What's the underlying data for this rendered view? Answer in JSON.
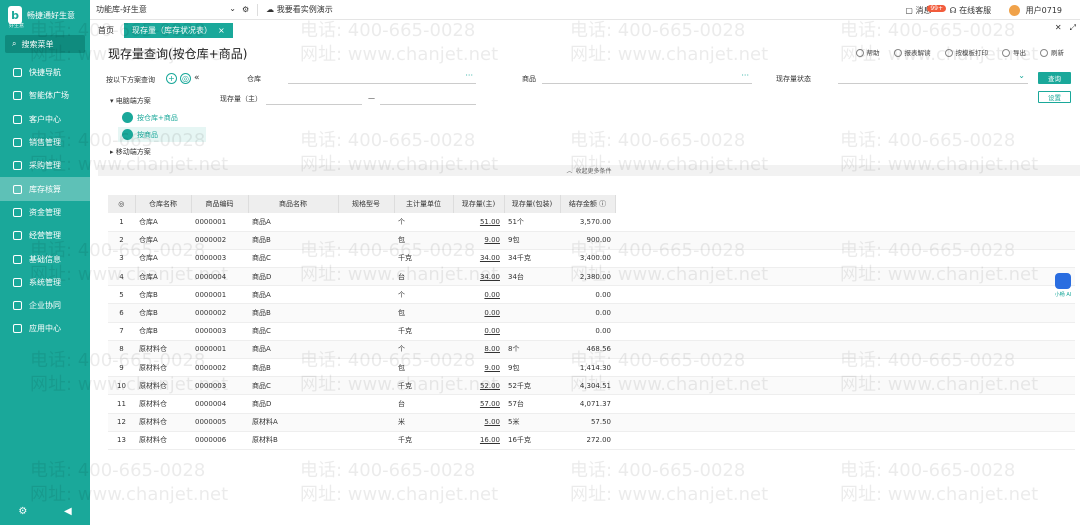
{
  "sidebar": {
    "brand": "畅捷通好生意",
    "brand_sub": "好生意",
    "search_label": "搜索菜单",
    "items": [
      {
        "label": "快捷导航",
        "icon": "home-icon"
      },
      {
        "label": "智能体广场",
        "icon": "robot-icon"
      },
      {
        "label": "客户中心",
        "icon": "customer-icon"
      },
      {
        "label": "销售管理",
        "icon": "sales-icon"
      },
      {
        "label": "采购管理",
        "icon": "purchase-icon"
      },
      {
        "label": "库存核算",
        "icon": "inventory-icon",
        "active": true
      },
      {
        "label": "资金管理",
        "icon": "fund-icon"
      },
      {
        "label": "经营管理",
        "icon": "business-icon"
      },
      {
        "label": "基础信息",
        "icon": "info-icon"
      },
      {
        "label": "系统管理",
        "icon": "system-icon"
      },
      {
        "label": "企业协同",
        "icon": "collab-icon"
      },
      {
        "label": "应用中心",
        "icon": "apps-icon"
      }
    ]
  },
  "topbar": {
    "func_library": "功能库-好生意",
    "demo_label": "我要看实例演示",
    "messages_label": "消息",
    "messages_badge": "99+",
    "service_label": "在线客服",
    "user_label": "用户0719"
  },
  "tabs": {
    "home": "首页",
    "active": "现存量（库存状况表）"
  },
  "header": {
    "title": "现存量查询(按仓库+商品)",
    "actions": [
      "帮助",
      "报表解读",
      "按模板打印",
      "导出",
      "刷新"
    ]
  },
  "scheme": {
    "title": "按以下方案查询",
    "group_pc": "电脑端方案",
    "item1": "按仓库+商品",
    "item2": "按商品",
    "group_mobile": "移动端方案"
  },
  "filters": {
    "warehouse_label": "仓库",
    "product_label": "商品",
    "status_label": "现存量状态",
    "qty_label": "现存量（主）",
    "range_sep": "—",
    "query_btn": "查询",
    "setting_btn": "设置",
    "collapse_label": "收起更多条件"
  },
  "table": {
    "columns": [
      "",
      "仓库名称",
      "商品编码",
      "商品名称",
      "规格型号",
      "主计量单位",
      "现存量(主)",
      "现存量(包装)",
      "结存金额 ⓘ"
    ],
    "rows": [
      [
        "1",
        "仓库A",
        "0000001",
        "商品A",
        "",
        "个",
        "51.00",
        "51个",
        "3,570.00"
      ],
      [
        "2",
        "仓库A",
        "0000002",
        "商品B",
        "",
        "包",
        "9.00",
        "9包",
        "900.00"
      ],
      [
        "3",
        "仓库A",
        "0000003",
        "商品C",
        "",
        "千克",
        "34.00",
        "34千克",
        "3,400.00"
      ],
      [
        "4",
        "仓库A",
        "0000004",
        "商品D",
        "",
        "台",
        "34.00",
        "34台",
        "2,380.00"
      ],
      [
        "5",
        "仓库B",
        "0000001",
        "商品A",
        "",
        "个",
        "0.00",
        "",
        "0.00"
      ],
      [
        "6",
        "仓库B",
        "0000002",
        "商品B",
        "",
        "包",
        "0.00",
        "",
        "0.00"
      ],
      [
        "7",
        "仓库B",
        "0000003",
        "商品C",
        "",
        "千克",
        "0.00",
        "",
        "0.00"
      ],
      [
        "8",
        "原材料仓",
        "0000001",
        "商品A",
        "",
        "个",
        "8.00",
        "8个",
        "468.56"
      ],
      [
        "9",
        "原材料仓",
        "0000002",
        "商品B",
        "",
        "包",
        "9.00",
        "9包",
        "1,414.30"
      ],
      [
        "10",
        "原材料仓",
        "0000003",
        "商品C",
        "",
        "千克",
        "52.00",
        "52千克",
        "4,304.51"
      ],
      [
        "11",
        "原材料仓",
        "0000004",
        "商品D",
        "",
        "台",
        "57.00",
        "57台",
        "4,071.37"
      ],
      [
        "12",
        "原材料仓",
        "0000005",
        "原材料A",
        "",
        "米",
        "5.00",
        "5米",
        "57.50"
      ],
      [
        "13",
        "原材料仓",
        "0000006",
        "原材料B",
        "",
        "千克",
        "16.00",
        "16千克",
        "272.00"
      ]
    ]
  },
  "ai_label": "小畅 AI",
  "watermark": {
    "phone": "电话: 400-665-0028",
    "site": "网址: www.chanjet.net"
  },
  "colors": {
    "accent": "#1aa89a",
    "active_nav": "#5ec1b7"
  }
}
